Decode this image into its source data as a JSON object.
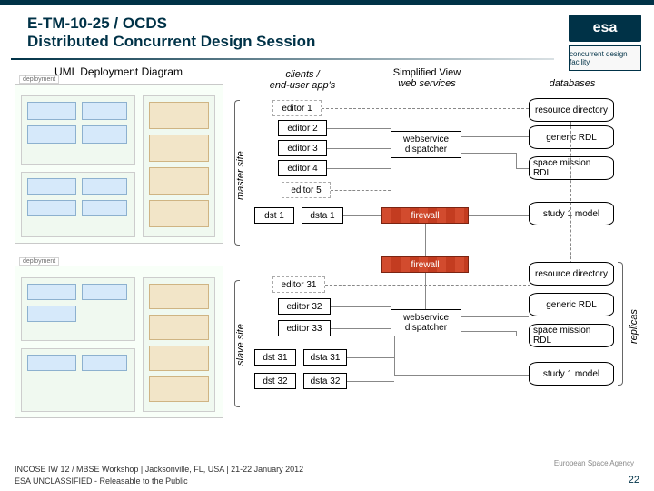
{
  "header": {
    "title_line1": "E-TM-10-25 / OCDS",
    "title_line2": "Distributed Concurrent Design Session",
    "logo_text": "esa",
    "cdf_text": "concurrent design facility"
  },
  "labels": {
    "uml_caption": "UML Deployment Diagram",
    "clients": "clients /",
    "clients2": "end-user app's",
    "simplified": "Simplified View",
    "webservices": "web services",
    "databases": "databases",
    "master_site": "master site",
    "slave_site": "slave site",
    "replicas": "replicas"
  },
  "master": {
    "editors": [
      "editor 1",
      "editor 2",
      "editor 3",
      "editor 4",
      "editor 5"
    ],
    "dsts": [
      "dst 1"
    ],
    "dstas": [
      "dsta 1"
    ],
    "dispatcher": "webservice\ndispatcher",
    "firewall": "firewall",
    "db": [
      "resource directory",
      "generic RDL",
      "space mission RDL",
      "study 1 model"
    ]
  },
  "slave": {
    "editors": [
      "editor 31",
      "editor 32",
      "editor 33"
    ],
    "dsts": [
      "dst 31",
      "dst 32"
    ],
    "dstas": [
      "dsta 31",
      "dsta 32"
    ],
    "dispatcher": "webservice\ndispatcher",
    "firewall": "firewall",
    "db": [
      "resource directory",
      "generic RDL",
      "space mission RDL",
      "study 1 model"
    ]
  },
  "footer": {
    "line1": "INCOSE IW 12 / MBSE Workshop | Jacksonville, FL, USA | 21-22 January 2012",
    "line2": "ESA UNCLASSIFIED - Releasable to the Public",
    "agency": "European Space Agency",
    "page": "22"
  }
}
